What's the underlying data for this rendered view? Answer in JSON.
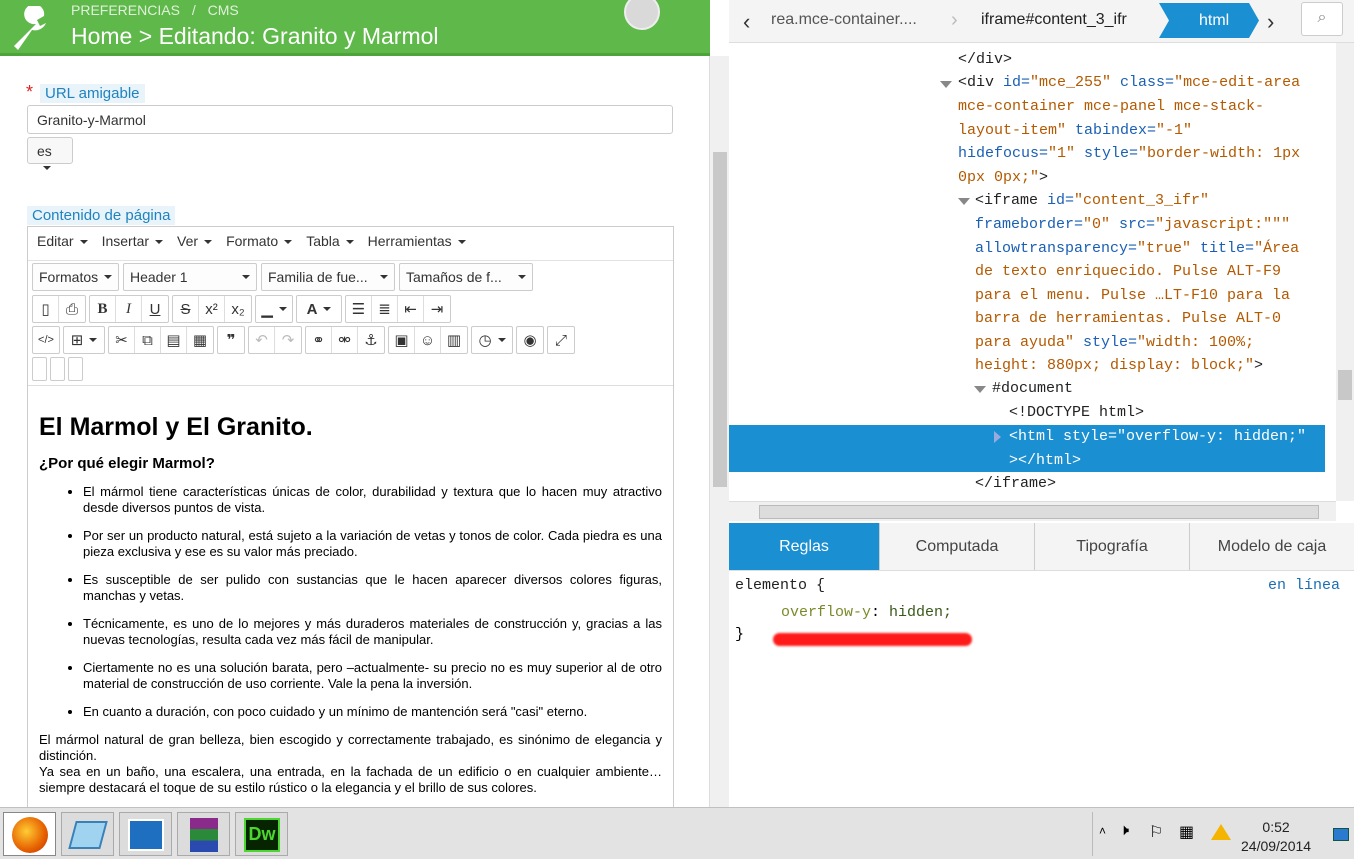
{
  "header": {
    "crumb_preferences": "PREFERENCIAS",
    "crumb_sep": "/",
    "crumb_cms": "CMS",
    "title": "Home > Editando: Granito y Marmol"
  },
  "form": {
    "url_label": "URL amigable",
    "url_value": "Granito-y-Marmol",
    "lang_value": "es",
    "content_label": "Contenido de página",
    "required_mark": "*"
  },
  "editor": {
    "menu": [
      "Editar",
      "Insertar",
      "Ver",
      "Formato",
      "Tabla",
      "Herramientas"
    ],
    "formats": "Formatos",
    "header": "Header 1",
    "font_family": "Familia de fue...",
    "font_size": "Tamaños de f...",
    "buttons": {
      "bold": "B",
      "italic": "I",
      "underline": "U",
      "strike": "S",
      "sup": "x²",
      "sub": "x₂",
      "color": "A",
      "code": "</>",
      "quote": "❞"
    },
    "content": {
      "h1": "El Marmol y El Granito.",
      "h2": "¿Por qué elegir Marmol?",
      "bullets": [
        "El mármol tiene características únicas de color, durabilidad y textura que lo hacen muy atractivo desde diversos puntos de vista.",
        "Por ser un producto natural, está sujeto a la variación de vetas y tonos de color. Cada piedra es una pieza exclusiva y ese es su valor más preciado.",
        "Es susceptible de ser pulido con sustancias que le hacen aparecer diversos colores figuras, manchas y vetas.",
        "Técnicamente, es uno de lo mejores y más duraderos materiales de construcción y, gracias a las nuevas tecnologías, resulta cada vez más fácil de manipular.",
        "Ciertamente no es una solución barata, pero –actualmente- su precio no es muy superior al de otro material de construcción de uso corriente. Vale la pena la inversión.",
        "En cuanto a duración, con poco cuidado y un mínimo de mantención será \"casi\" eterno."
      ],
      "p1": "El mármol natural de gran belleza, bien escogido y correctamente trabajado, es sinónimo de elegancia y distinción.",
      "p2": "Ya sea en un baño, una escalera, una entrada, en la fachada de un edificio o en cualquier ambiente… siempre destacará el toque de su estilo rústico o la elegancia y el brillo de sus colores."
    }
  },
  "devtools": {
    "crumbs": [
      "rea.mce-container....",
      "iframe#content_3_ifr",
      "html"
    ],
    "dom": {
      "l1": "</div>",
      "l2_tag": "<div ",
      "l2_id_attr": "id=",
      "l2_id_val": "\"mce_255\"",
      "l2_class_attr": " class=",
      "l2_class_val": "\"mce-edit-area",
      "l3": "mce-container mce-panel mce-stack-",
      "l4_val": "layout-item\"",
      "l4_attr": " tabindex=",
      "l4_val2": "\"-1\"",
      "l5_attr": "hidefocus=",
      "l5_val": "\"1\"",
      "l5_attr2": " style=",
      "l5_val2": "\"border-width: 1px",
      "l6_val": "0px 0px;\"",
      "l6_end": ">",
      "l7_tag": "<iframe ",
      "l7_attr": "id=",
      "l7_val": "\"content_3_ifr\"",
      "l8_attr": "frameborder=",
      "l8_val": "\"0\"",
      "l8_attr2": " src=",
      "l8_val2": "\"javascript:\"\"\"",
      "l9_attr": "allowtransparency=",
      "l9_val": "\"true\"",
      "l9_attr2": " title=",
      "l9_val2": "\"Área",
      "l10": "de texto enriquecido. Pulse ALT-F9",
      "l11": "para el menu. Pulse …LT-F10 para la",
      "l12": "barra de herramientas. Pulse ALT-0",
      "l13_val": "para ayuda\"",
      "l13_attr": " style=",
      "l13_val2": "\"width: 100%;",
      "l14_val": "height: 880px; display: block;\"",
      "l14_end": ">",
      "l15": "#document",
      "l16": "<!DOCTYPE html>",
      "l17": "<html style=\"overflow-y: hidden;\"",
      "l18": "></html>",
      "l19": "</iframe>"
    },
    "tabs": [
      "Reglas",
      "Computada",
      "Tipografía",
      "Modelo de caja"
    ],
    "rules": {
      "selector": "elemento {",
      "source": "en línea",
      "prop": "overflow-y",
      "value": "hidden;",
      "close": "}"
    }
  },
  "taskbar": {
    "time": "0:52",
    "date": "24/09/2014",
    "dw_label": "Dw"
  },
  "colors": {
    "header_green": "#5fb94a",
    "devtools_blue": "#1a8fd1",
    "highlight_red": "#ff1a1a"
  }
}
